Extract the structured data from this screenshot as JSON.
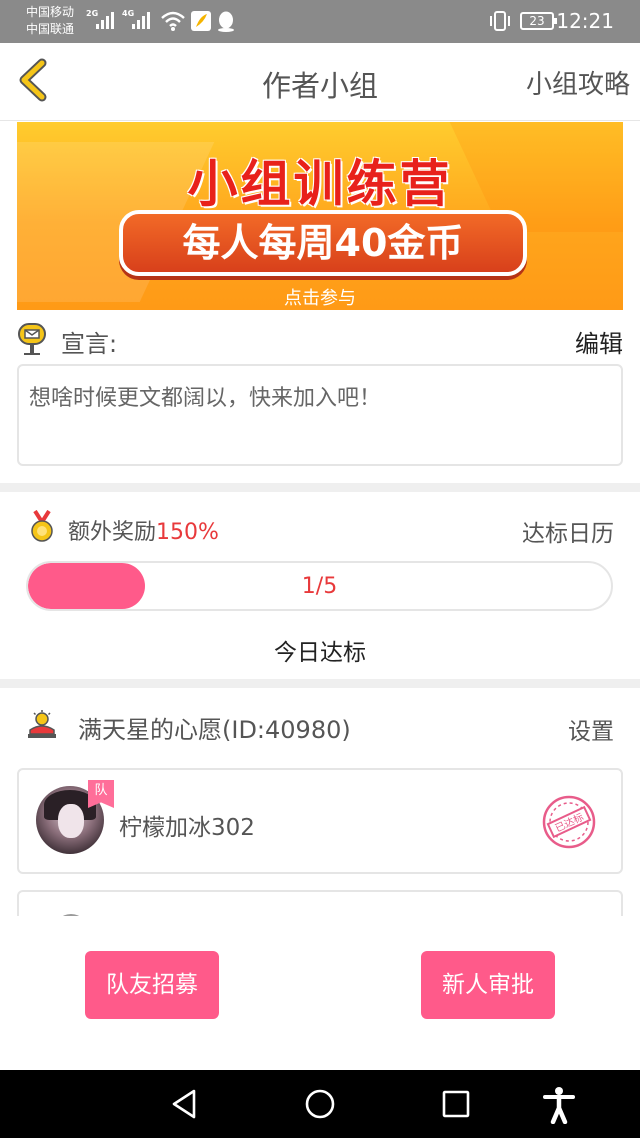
{
  "status_bar": {
    "carrier_1": "中国移动",
    "carrier_2": "中国联通",
    "net_1": "2G",
    "net_2": "4G",
    "battery": "23",
    "time": "12:21"
  },
  "header": {
    "title": "作者小组",
    "guide_link": "小组攻略"
  },
  "banner": {
    "headline": "小组训练营",
    "reward": "每人每周40金币",
    "cta": "点击参与"
  },
  "declaration": {
    "label": "宣言:",
    "edit": "编辑",
    "text": "想啥时候更文都阔以，快来加入吧！"
  },
  "bonus": {
    "label": "额外奖励",
    "percent": "150%",
    "calendar": "达标日历",
    "progress_text": "1/5",
    "progress_fraction": 0.2,
    "today": "今日达标"
  },
  "wish": {
    "title": "满天星的心愿(ID:40980)",
    "settings": "设置"
  },
  "members": [
    {
      "name": "柠檬加冰302",
      "badge": "队",
      "stamp": "已达标"
    }
  ],
  "buttons": {
    "recruit": "队友招募",
    "approve": "新人审批"
  },
  "colors": {
    "accent": "#ff5a8a",
    "highlight_red": "#e8393b",
    "back_arrow": "#f5c518"
  }
}
